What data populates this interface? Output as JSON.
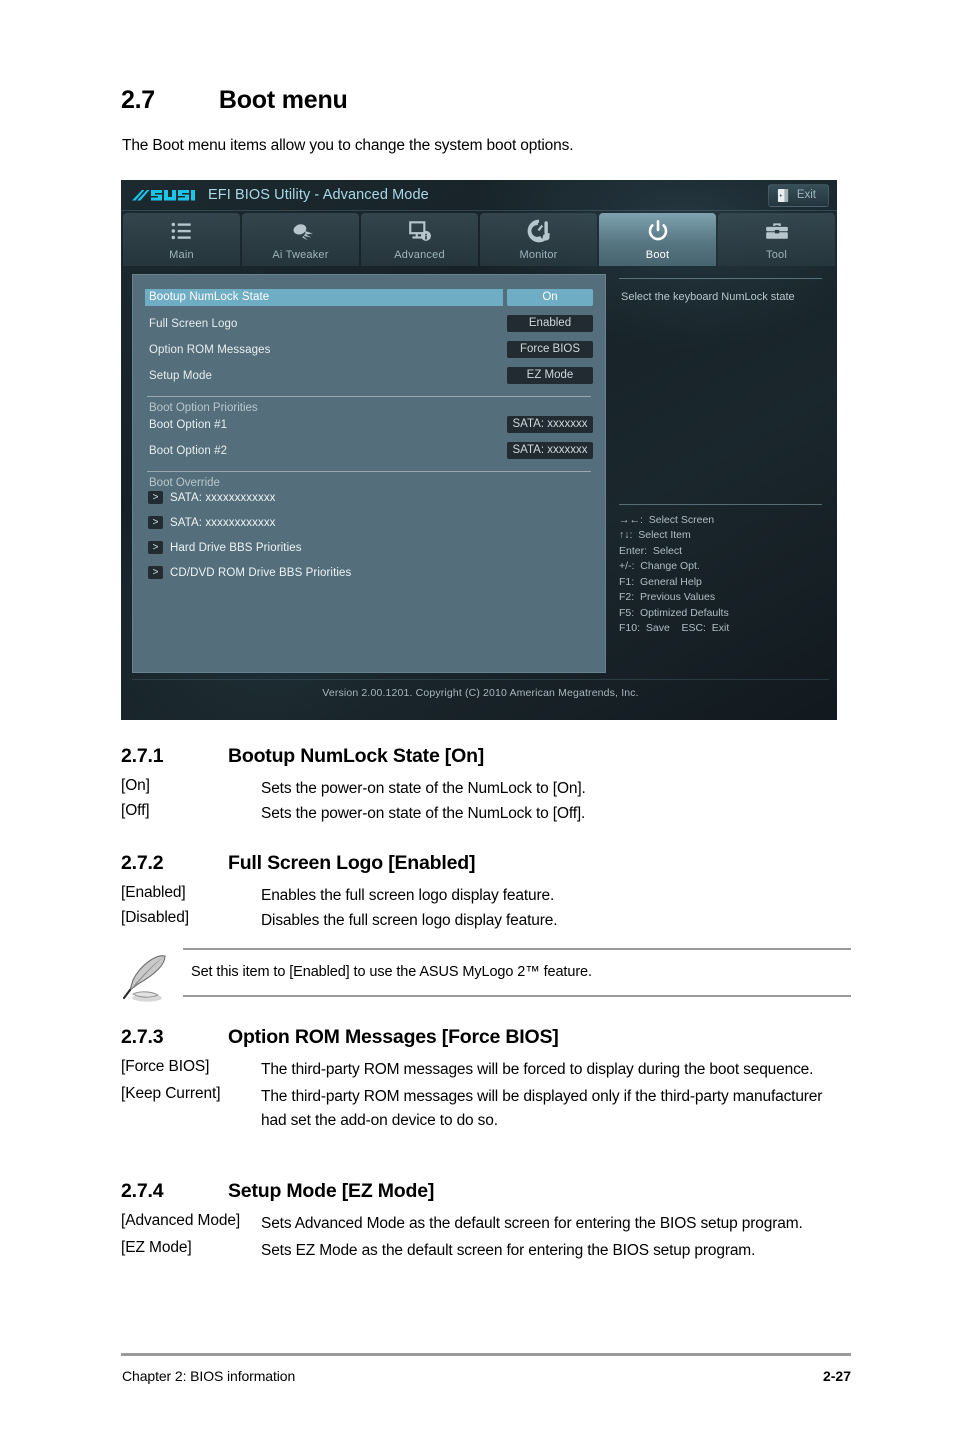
{
  "heading": {
    "number": "2.7",
    "title": "Boot menu",
    "intro": "The Boot menu items allow you to change the system boot options."
  },
  "bios": {
    "brand": "ASUS",
    "title": "EFI BIOS Utility - Advanced Mode",
    "exit_label": "Exit",
    "exit_icon": "exit-door-icon",
    "tabs": [
      {
        "label": "Main",
        "icon": "list-icon",
        "active": false
      },
      {
        "label": "Ai  Tweaker",
        "icon": "comet-icon",
        "active": false
      },
      {
        "label": "Advanced",
        "icon": "monitor-info-icon",
        "active": false
      },
      {
        "label": "Monitor",
        "icon": "gauge-thermometer-icon",
        "active": false
      },
      {
        "label": "Boot",
        "icon": "power-icon",
        "active": true
      },
      {
        "label": "Tool",
        "icon": "toolbox-icon",
        "active": false
      }
    ],
    "settings": [
      {
        "label": "Bootup NumLock State",
        "value": "On",
        "selected": true
      },
      {
        "label": "Full Screen Logo",
        "value": "Enabled",
        "selected": false
      },
      {
        "label": "Option ROM Messages",
        "value": "Force BIOS",
        "selected": false
      },
      {
        "label": "Setup Mode",
        "value": "EZ Mode",
        "selected": false
      }
    ],
    "boot_priorities_title": "Boot Option Priorities",
    "boot_priorities": [
      {
        "label": "Boot Option #1",
        "value": "SATA: xxxxxxx"
      },
      {
        "label": "Boot Option #2",
        "value": "SATA: xxxxxxx"
      }
    ],
    "boot_override_title": "Boot Override",
    "boot_override": [
      {
        "arrow": ">",
        "label": "SATA: xxxxxxxxxxxx"
      },
      {
        "arrow": ">",
        "label": "SATA: xxxxxxxxxxxx"
      },
      {
        "arrow": ">",
        "label": "Hard Drive BBS Priorities"
      },
      {
        "arrow": ">",
        "label": "CD/DVD ROM Drive BBS Priorities"
      }
    ],
    "help_text": "Select the keyboard NumLock state",
    "key_legend": [
      "→←:  Select Screen",
      "↑↓:  Select Item",
      "Enter:  Select",
      "+/-:  Change Opt.",
      "F1:  General Help",
      "F2:  Previous Values",
      "F5:  Optimized Defaults",
      "F10:  Save    ESC:  Exit"
    ],
    "footer": "Version  2.00.1201.   Copyright  (C)  2010  American  Megatrends,  Inc.",
    "colors": {
      "highlight": "#6fadc4",
      "panel": "#546f7b",
      "value_box": "#222b31",
      "title_text": "#a9d8e6"
    }
  },
  "sections": [
    {
      "number": "2.7.1",
      "title": "Bootup NumLock State [On]",
      "defs": [
        {
          "key": "[On]",
          "value": "Sets the power-on state of the NumLock to [On]."
        },
        {
          "key": "[Off]",
          "value": "Sets the power-on state of the NumLock to [Off]."
        }
      ]
    },
    {
      "number": "2.7.2",
      "title": "Full Screen Logo [Enabled]",
      "defs": [
        {
          "key": "[Enabled]",
          "value": "Enables the full screen logo display feature."
        },
        {
          "key": "[Disabled]",
          "value": "Disables the full screen logo display feature."
        }
      ]
    },
    {
      "number": "2.7.3",
      "title": "Option ROM Messages [Force BIOS]",
      "defs": [
        {
          "key": "[Force BIOS]",
          "value": "The third-party ROM messages will be forced to display during the boot sequence."
        },
        {
          "key": "[Keep Current]",
          "value": "The third-party ROM messages will be displayed only if the third-party manufacturer had set the add-on device to do so."
        }
      ]
    },
    {
      "number": "2.7.4",
      "title": "Setup Mode [EZ Mode]",
      "defs": [
        {
          "key": "[Advanced Mode]",
          "value": "Sets Advanced Mode as the default screen for entering the BIOS setup program."
        },
        {
          "key": "[EZ Mode]",
          "value": "Sets EZ Mode as the default screen for entering the BIOS setup program."
        }
      ]
    }
  ],
  "note": {
    "icon": "pencil-note-icon",
    "text": "Set this item to [Enabled] to use the ASUS MyLogo 2™ feature."
  },
  "page_footer": {
    "left": "Chapter 2: BIOS information",
    "right": "2-27"
  }
}
